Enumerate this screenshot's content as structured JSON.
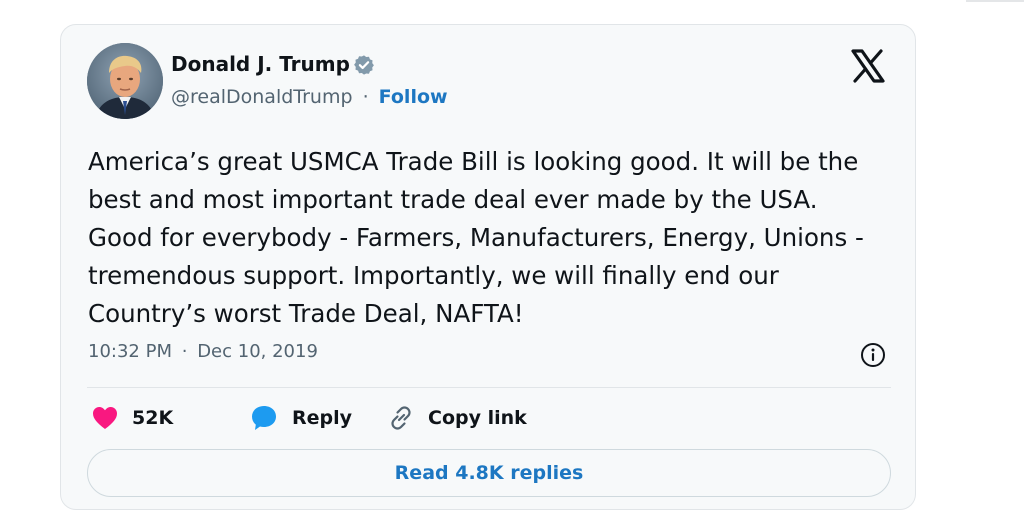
{
  "author": {
    "name": "Donald J. Trump",
    "handle": "@realDonaldTrump",
    "separator": "·",
    "follow_label": "Follow",
    "avatar_icon": "profile-photo",
    "verified_icon": "verified-badge-icon"
  },
  "brand": {
    "logo_icon": "x-logo-icon"
  },
  "tweet": {
    "text": "America’s great USMCA Trade Bill is looking good. It will be the best and most important trade deal ever made by the USA. Good for everybody - Farmers, Manufacturers, Energy, Unions - tremendous support. Importantly, we will finally end our Country’s worst Trade Deal, NAFTA!",
    "time": "10:32 PM",
    "separator": "·",
    "date": "Dec 10, 2019",
    "info_icon": "info-icon"
  },
  "actions": {
    "like_count": "52K",
    "like_icon": "heart-icon",
    "reply_label": "Reply",
    "reply_icon": "speech-bubble-icon",
    "copy_label": "Copy link",
    "copy_icon": "link-icon"
  },
  "replies_button": {
    "label": "Read 4.8K replies"
  },
  "colors": {
    "card_background": "#f7f9fa",
    "text": "#0f1419",
    "secondary_text": "#536471",
    "link_blue": "#1d77c2",
    "heart": "#f91880",
    "verified": "#829aab"
  }
}
